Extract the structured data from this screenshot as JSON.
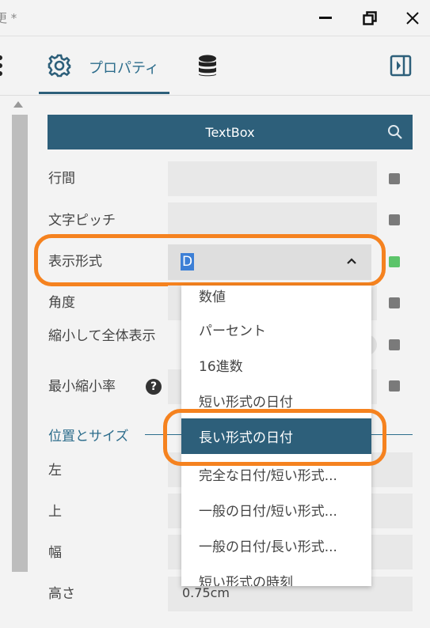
{
  "window": {
    "title": "更 *"
  },
  "toolbar": {
    "tab_properties": "プロパティ"
  },
  "panel": {
    "header_title": "TextBox",
    "fields": {
      "line_spacing": "行間",
      "char_pitch": "文字ピッチ",
      "display_format": "表示形式",
      "display_format_value": "D",
      "angle": "角度",
      "shrink_to_fit": "縮小して全体表示",
      "min_shrink_rate": "最小縮小率"
    },
    "section_position_size": "位置とサイズ",
    "position": {
      "left": "左",
      "top": "上",
      "width": "幅",
      "height": "高さ",
      "height_value": "0.75cm"
    }
  },
  "dropdown": {
    "items": [
      "数値",
      "パーセント",
      "16進数",
      "短い形式の日付",
      "長い形式の日付",
      "完全な日付/短い形式...",
      "一般の日付/短い形式...",
      "一般の日付/長い形式...",
      "短い形式の時刻"
    ],
    "selected_index": 4
  },
  "colors": {
    "accent": "#2d5f7a",
    "highlight": "#f5821f",
    "status_green": "#5cc46a"
  }
}
